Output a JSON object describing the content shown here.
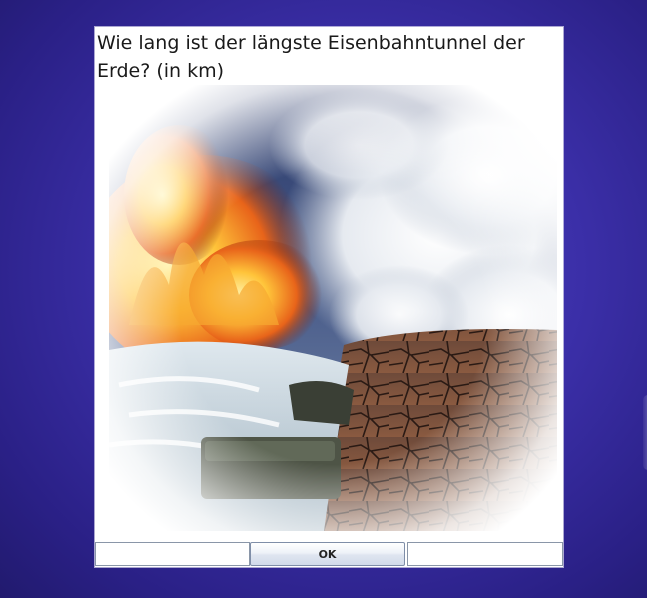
{
  "quiz": {
    "question": "Wie lang ist der längste Eisenbahntunnel der Erde? (in km)",
    "image": "elements-collage-fire-water-clouds-earth"
  },
  "answer": {
    "left_value": "",
    "right_value": ""
  },
  "buttons": {
    "ok_label": "OK"
  },
  "colors": {
    "background": "#3b2fa8",
    "dialog": "#ffffff"
  }
}
